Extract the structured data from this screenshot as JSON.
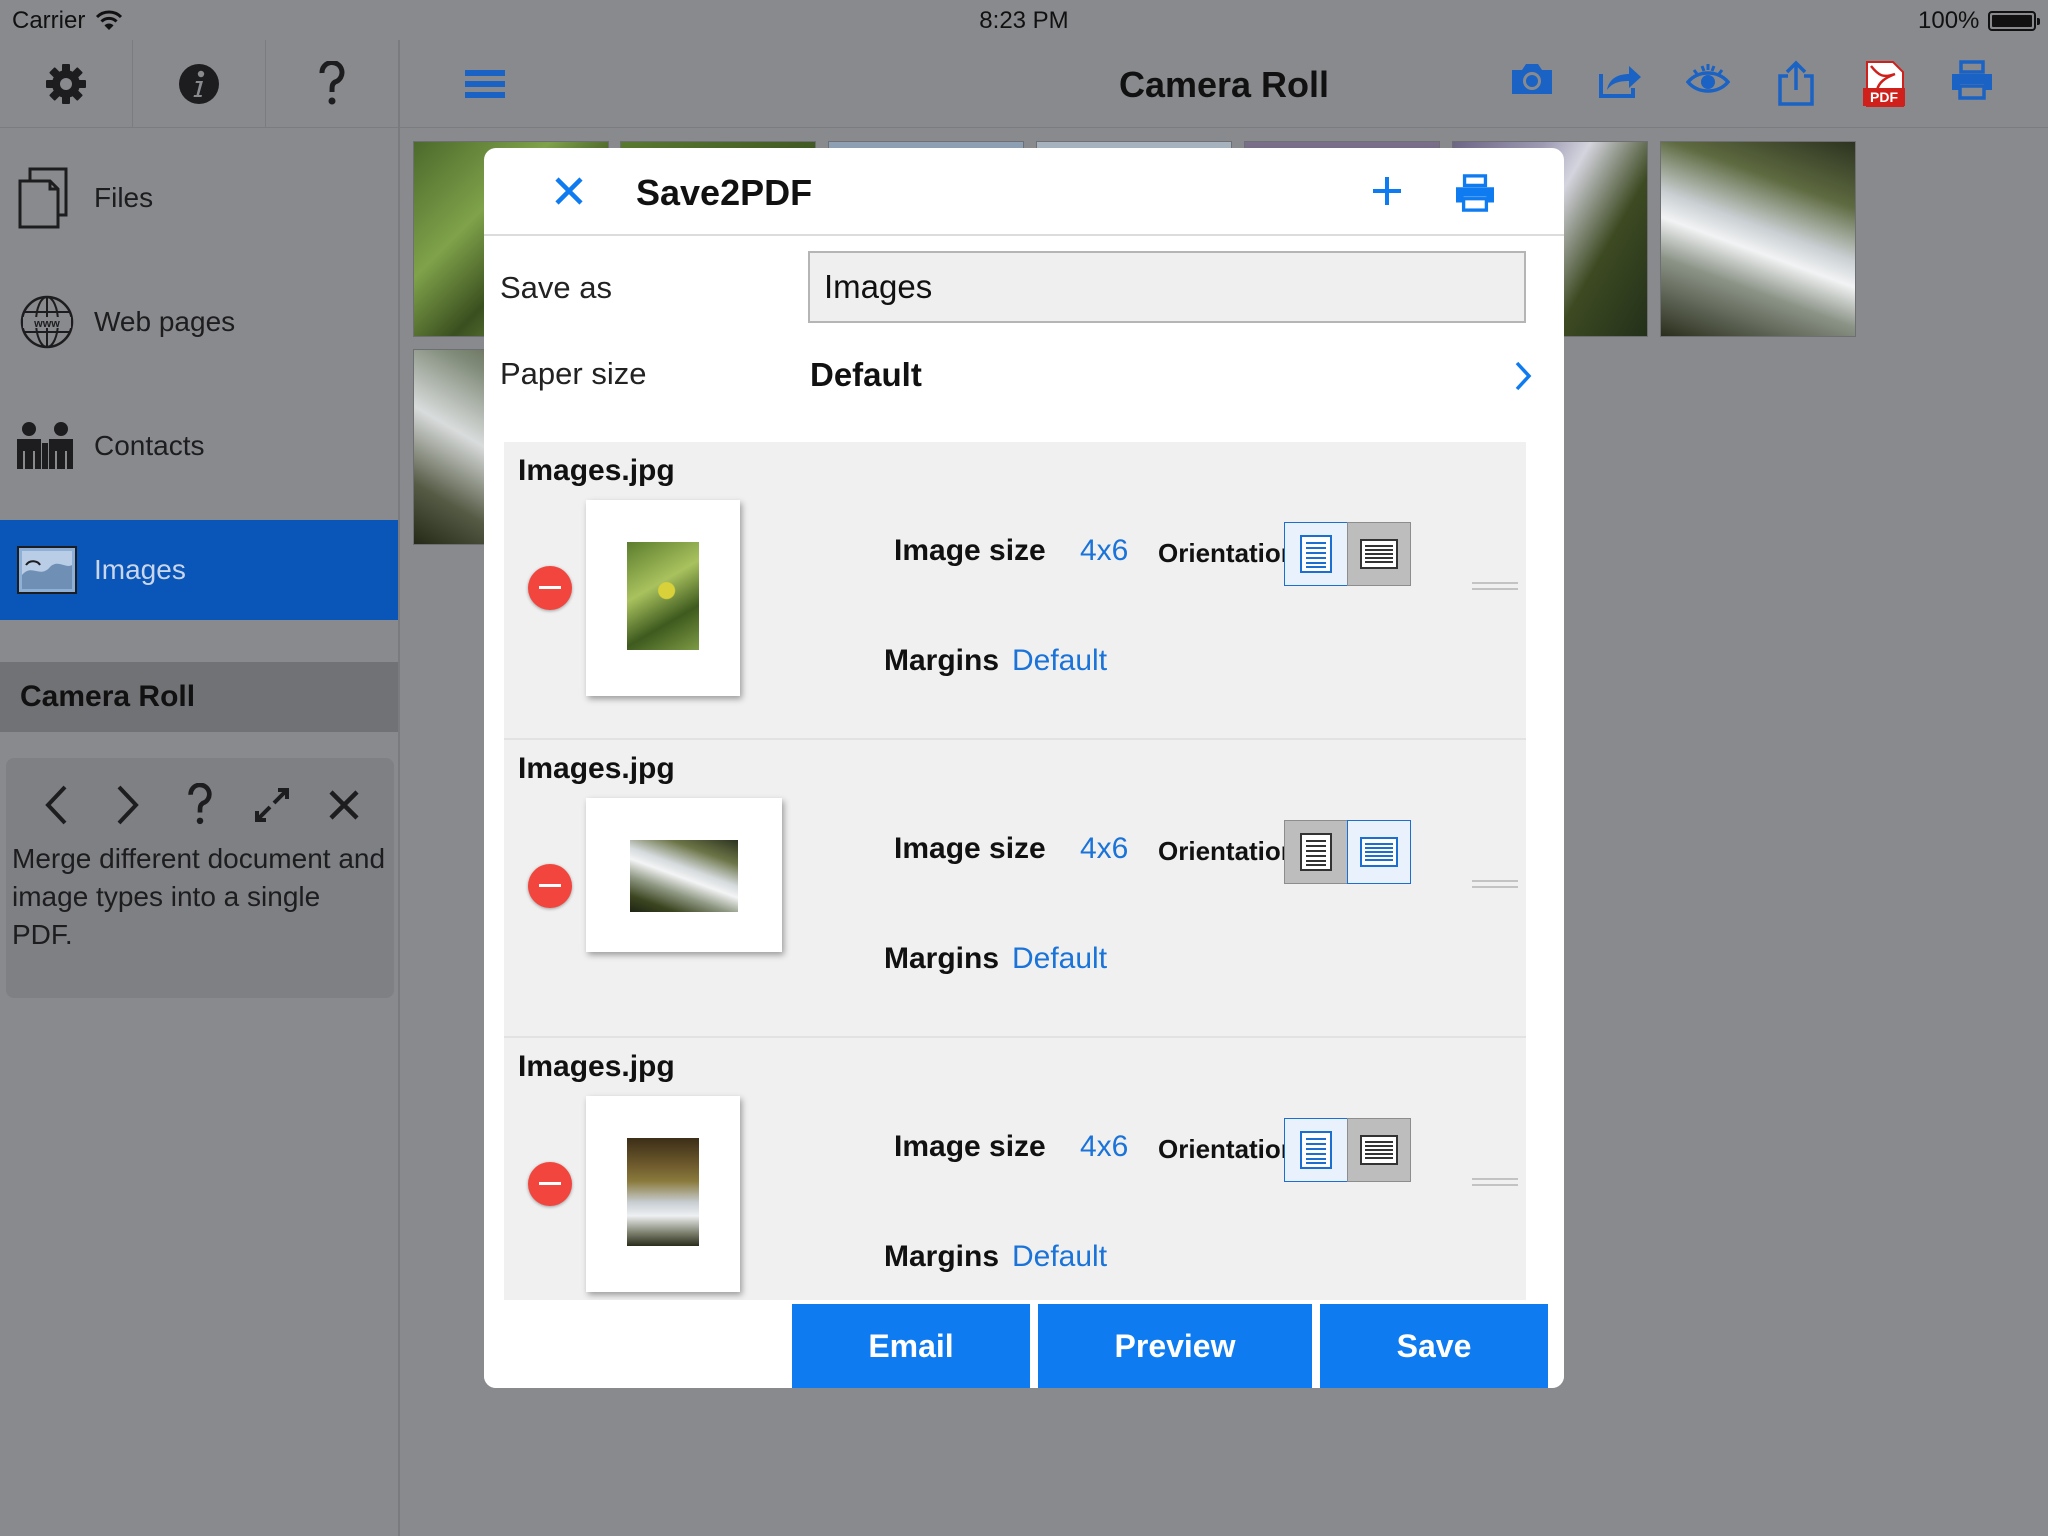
{
  "status_bar": {
    "carrier": "Carrier",
    "time": "8:23 PM",
    "battery": "100%"
  },
  "sidebar": {
    "toolbar": [
      {
        "icon": "gear-icon"
      },
      {
        "icon": "info-icon"
      },
      {
        "icon": "help-icon"
      }
    ],
    "items": [
      {
        "label": "Files",
        "icon": "files-icon",
        "selected": false
      },
      {
        "label": "Web pages",
        "icon": "globe-icon",
        "selected": false
      },
      {
        "label": "Contacts",
        "icon": "contacts-icon",
        "selected": false
      },
      {
        "label": "Images",
        "icon": "images-icon",
        "selected": true
      }
    ],
    "section_title": "Camera Roll",
    "help": {
      "text": "Merge different document and image types into a single PDF."
    }
  },
  "main": {
    "title": "Camera Roll",
    "toolbar_icons": [
      "camera-icon",
      "forward-icon",
      "eye-icon",
      "share-icon",
      "pdf-icon",
      "print-icon"
    ]
  },
  "dialog": {
    "title": "Save2PDF",
    "save_as_label": "Save as",
    "save_as_value": "Images",
    "paper_size_label": "Paper size",
    "paper_size_value": "Default",
    "items": [
      {
        "filename": "Images.jpg",
        "image_size_label": "Image size",
        "image_size": "4x6",
        "orientation_label": "Orientation",
        "orientation": "portrait",
        "margins_label": "Margins",
        "margins": "Default"
      },
      {
        "filename": "Images.jpg",
        "image_size_label": "Image size",
        "image_size": "4x6",
        "orientation_label": "Orientation",
        "orientation": "landscape",
        "margins_label": "Margins",
        "margins": "Default"
      },
      {
        "filename": "Images.jpg",
        "image_size_label": "Image size",
        "image_size": "4x6",
        "orientation_label": "Orientation",
        "orientation": "portrait",
        "margins_label": "Margins",
        "margins": "Default"
      }
    ],
    "buttons": {
      "email": "Email",
      "preview": "Preview",
      "save": "Save"
    }
  },
  "colors": {
    "accent": "#0f7bf0",
    "selected": "#0a55b8",
    "remove": "#f1453d",
    "toolbar_icon": "#1a62c4",
    "pdf_red": "#d0201b"
  }
}
